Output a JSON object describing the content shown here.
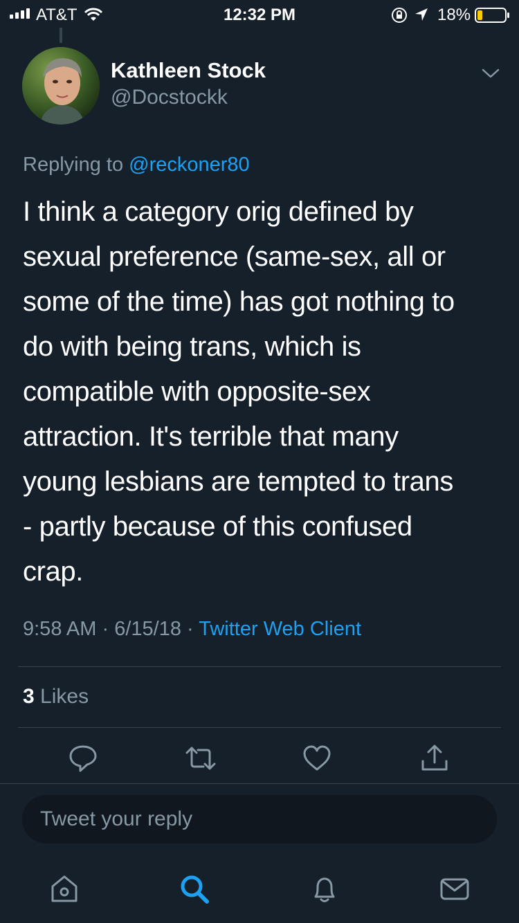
{
  "status_bar": {
    "carrier": "AT&T",
    "time": "12:32 PM",
    "battery_percent": "18%",
    "battery_level": 0.18,
    "battery_color": "#ffcc00"
  },
  "tweet": {
    "author_name": "Kathleen Stock",
    "author_handle": "@Docstockk",
    "replying_prefix": "Replying to",
    "replying_to": "@reckoner80",
    "text": "I think a category orig defined by\nsexual preference (same-sex, all or\nsome of the time) has got nothing to\ndo with being trans, which is\ncompatible with opposite-sex\nattraction.  It's terrible that many\nyoung lesbians are tempted to trans\n- partly because of this confused\ncrap.",
    "time": "9:58 AM",
    "date": "6/15/18",
    "separator": "·",
    "client": "Twitter Web Client",
    "likes_count": "3",
    "likes_label": "Likes"
  },
  "actions": [
    "reply-icon",
    "retweet-icon",
    "like-icon",
    "share-icon"
  ],
  "reply_box": {
    "placeholder": "Tweet your reply"
  },
  "tab_bar": [
    "home-icon",
    "search-icon",
    "notifications-icon",
    "messages-icon"
  ],
  "colors": {
    "background": "#15202b",
    "accent": "#1da1f2",
    "secondary_text": "#8899a6",
    "divider": "#38444d"
  }
}
